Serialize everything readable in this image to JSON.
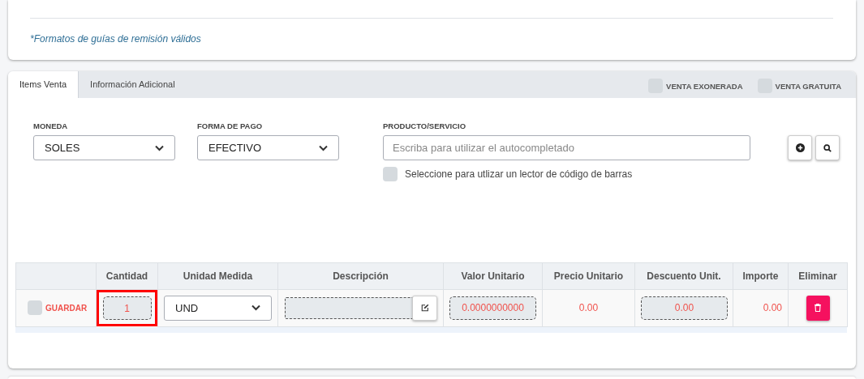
{
  "top_card": {
    "note": "*Formatos de guías de remisión válidos"
  },
  "tabs": [
    {
      "label": "Items Venta",
      "selected": true
    },
    {
      "label": "Información Adicional",
      "selected": false
    }
  ],
  "toggles": [
    {
      "label": "VENTA EXONERADA",
      "checked": false
    },
    {
      "label": "VENTA GRATUITA",
      "checked": false
    }
  ],
  "form": {
    "moneda": {
      "label": "MONEDA",
      "value": "SOLES"
    },
    "forma_pago": {
      "label": "FORMA DE PAGO",
      "value": "EFECTIVO"
    },
    "producto": {
      "label": "PRODUCTO/SERVICIO",
      "placeholder": "Escriba para utilizar el autocompletado"
    },
    "barcode": {
      "label": "Seleccione para utlizar un lector de código de barras",
      "checked": false
    }
  },
  "table": {
    "columns": [
      "Cantidad",
      "Unidad Medida",
      "Descripción",
      "Valor Unitario",
      "Precio Unitario",
      "Descuento Unit.",
      "Importe",
      "Eliminar"
    ],
    "rows": [
      {
        "checked": false,
        "action": "GUARDAR",
        "cantidad": "1",
        "cantidad_error": true,
        "unidad": "UND",
        "valor_unitario": "0.0000000000",
        "precio_unitario": "0.00",
        "descuento": "0.00",
        "importe": "0.00"
      }
    ]
  }
}
